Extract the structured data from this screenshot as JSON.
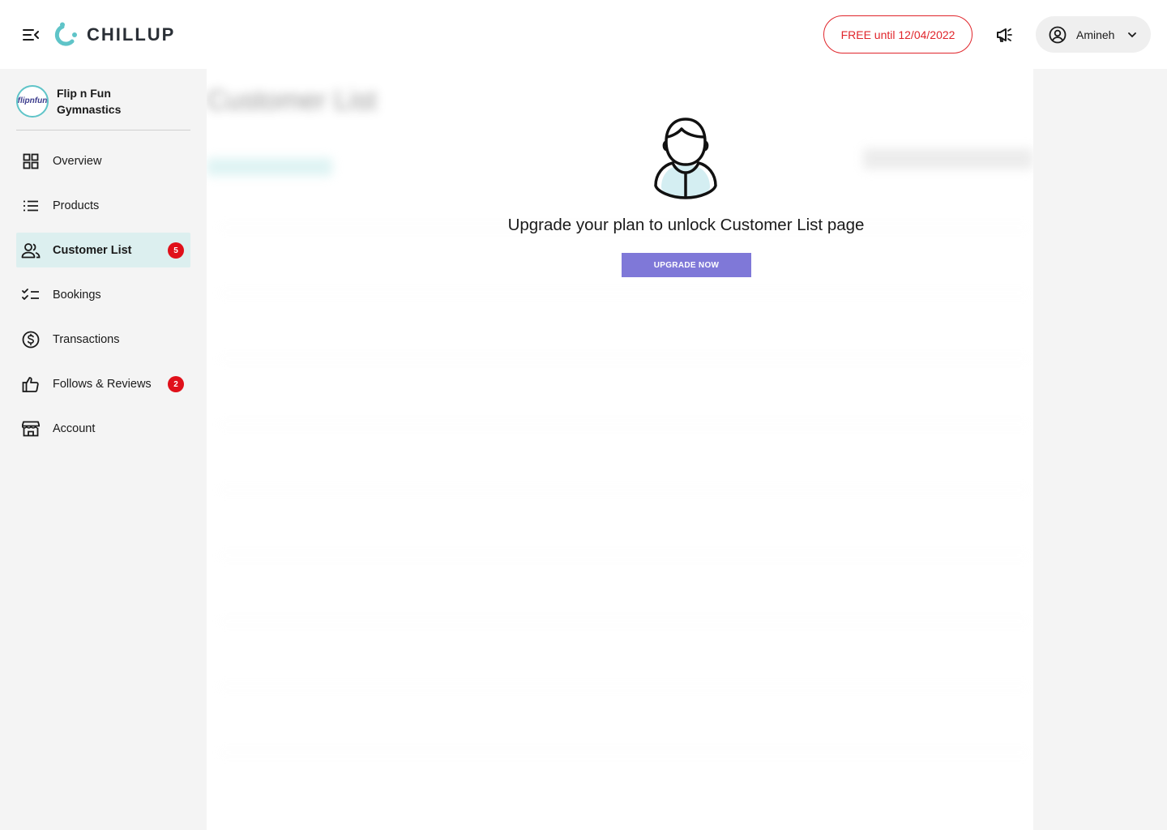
{
  "brand": {
    "name": "CHILLUP"
  },
  "header": {
    "plan_label": "FREE until 12/04/2022",
    "user_name": "Amineh"
  },
  "org": {
    "name_line1": "Flip n Fun",
    "name_line2": "Gymnastics",
    "avatar_text": "flipnfun"
  },
  "nav": {
    "items": [
      {
        "label": "Overview",
        "icon": "grid-icon"
      },
      {
        "label": "Products",
        "icon": "list-icon"
      },
      {
        "label": "Customer List",
        "icon": "people-icon",
        "active": true,
        "badge": "5"
      },
      {
        "label": "Bookings",
        "icon": "checklist-icon"
      },
      {
        "label": "Transactions",
        "icon": "dollar-circle-icon"
      },
      {
        "label": "Follows & Reviews",
        "icon": "thumbs-up-icon",
        "badge": "2"
      },
      {
        "label": "Account",
        "icon": "store-icon"
      }
    ]
  },
  "main": {
    "title": "Customer List",
    "lock_message": "Upgrade your plan to unlock Customer List page",
    "upgrade_label": "UPGRADE NOW"
  },
  "colors": {
    "accent": "#5fc4c8",
    "plan_red": "#e0252b",
    "badge_red": "#e0101a",
    "active_bg": "#dcefef",
    "upgrade_purple": "#7f78d8"
  }
}
